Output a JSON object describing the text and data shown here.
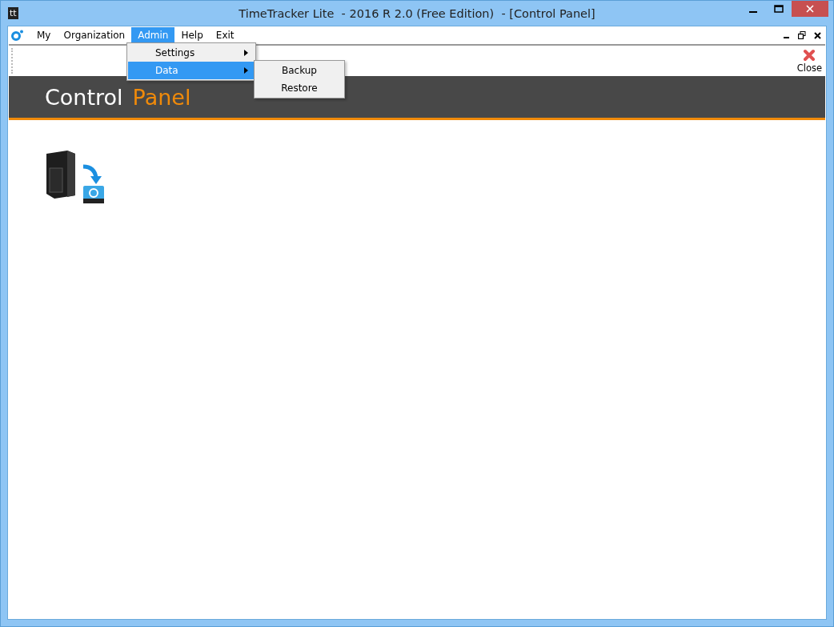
{
  "window": {
    "title": "TimeTracker Lite  - 2016 R 2.0 (Free Edition)  - [Control Panel]",
    "app_icon_text": "tt"
  },
  "menu": [
    {
      "label": "My",
      "selected": false
    },
    {
      "label": "Organization",
      "selected": false
    },
    {
      "label": "Admin",
      "selected": true
    },
    {
      "label": "Help",
      "selected": false
    },
    {
      "label": "Exit",
      "selected": false
    }
  ],
  "admin_menu": [
    {
      "label": "Settings",
      "highlighted": false
    },
    {
      "label": "Data",
      "highlighted": true
    }
  ],
  "data_submenu": [
    {
      "label": "Backup"
    },
    {
      "label": "Restore"
    }
  ],
  "toolbar": {
    "close_label": "Close"
  },
  "header": {
    "title_first": "Control",
    "title_second": "Panel"
  }
}
